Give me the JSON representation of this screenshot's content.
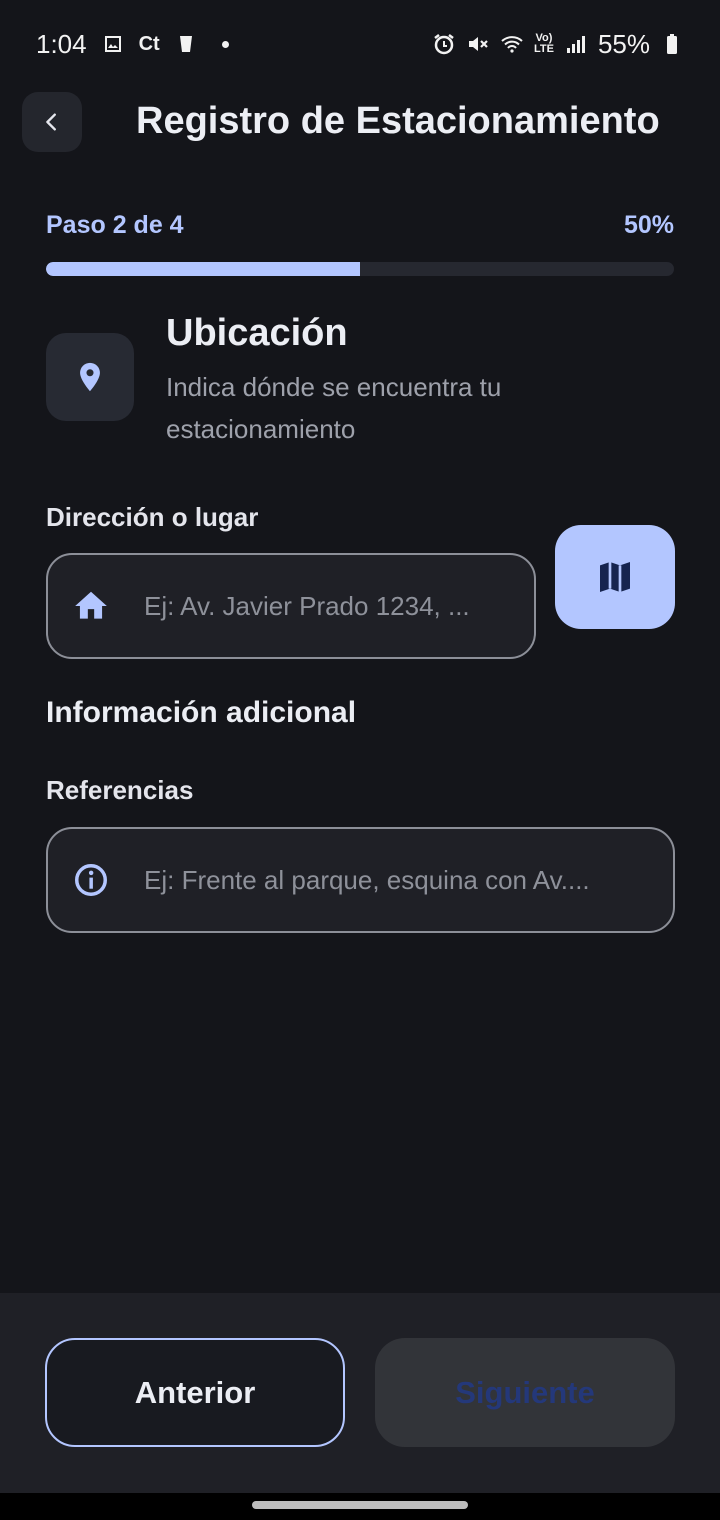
{
  "status_bar": {
    "time": "1:04",
    "carrier_icon_text": "Ct",
    "battery": "55%",
    "icons_left": [
      "image-icon",
      "carrier-icon",
      "cup-icon",
      "dot-icon"
    ],
    "icons_right": [
      "alarm-icon",
      "mute-icon",
      "wifi-icon",
      "volte-icon",
      "signal-icon",
      "battery-icon"
    ]
  },
  "header": {
    "title": "Registro de Estacionamiento",
    "back_icon": "chevron-left-icon"
  },
  "progress": {
    "step_text": "Paso 2 de 4",
    "percent_text": "50%",
    "value": 0.5
  },
  "section": {
    "icon": "location-pin-icon",
    "title": "Ubicación",
    "subtitle": "Indica dónde se encuentra tu estacionamiento"
  },
  "address": {
    "label": "Dirección o lugar",
    "placeholder": "Ej: Av. Javier Prado 1234, ...",
    "icon": "home-icon",
    "map_button_icon": "map-icon"
  },
  "additional": {
    "heading": "Información adicional",
    "references_label": "Referencias",
    "references_placeholder": "Ej: Frente al parque, esquina con Av....",
    "icon": "info-icon"
  },
  "footer": {
    "previous_label": "Anterior",
    "next_label": "Siguiente"
  },
  "colors": {
    "background": "#14151a",
    "accent": "#b3c6ff",
    "surface": "#1f2026"
  }
}
